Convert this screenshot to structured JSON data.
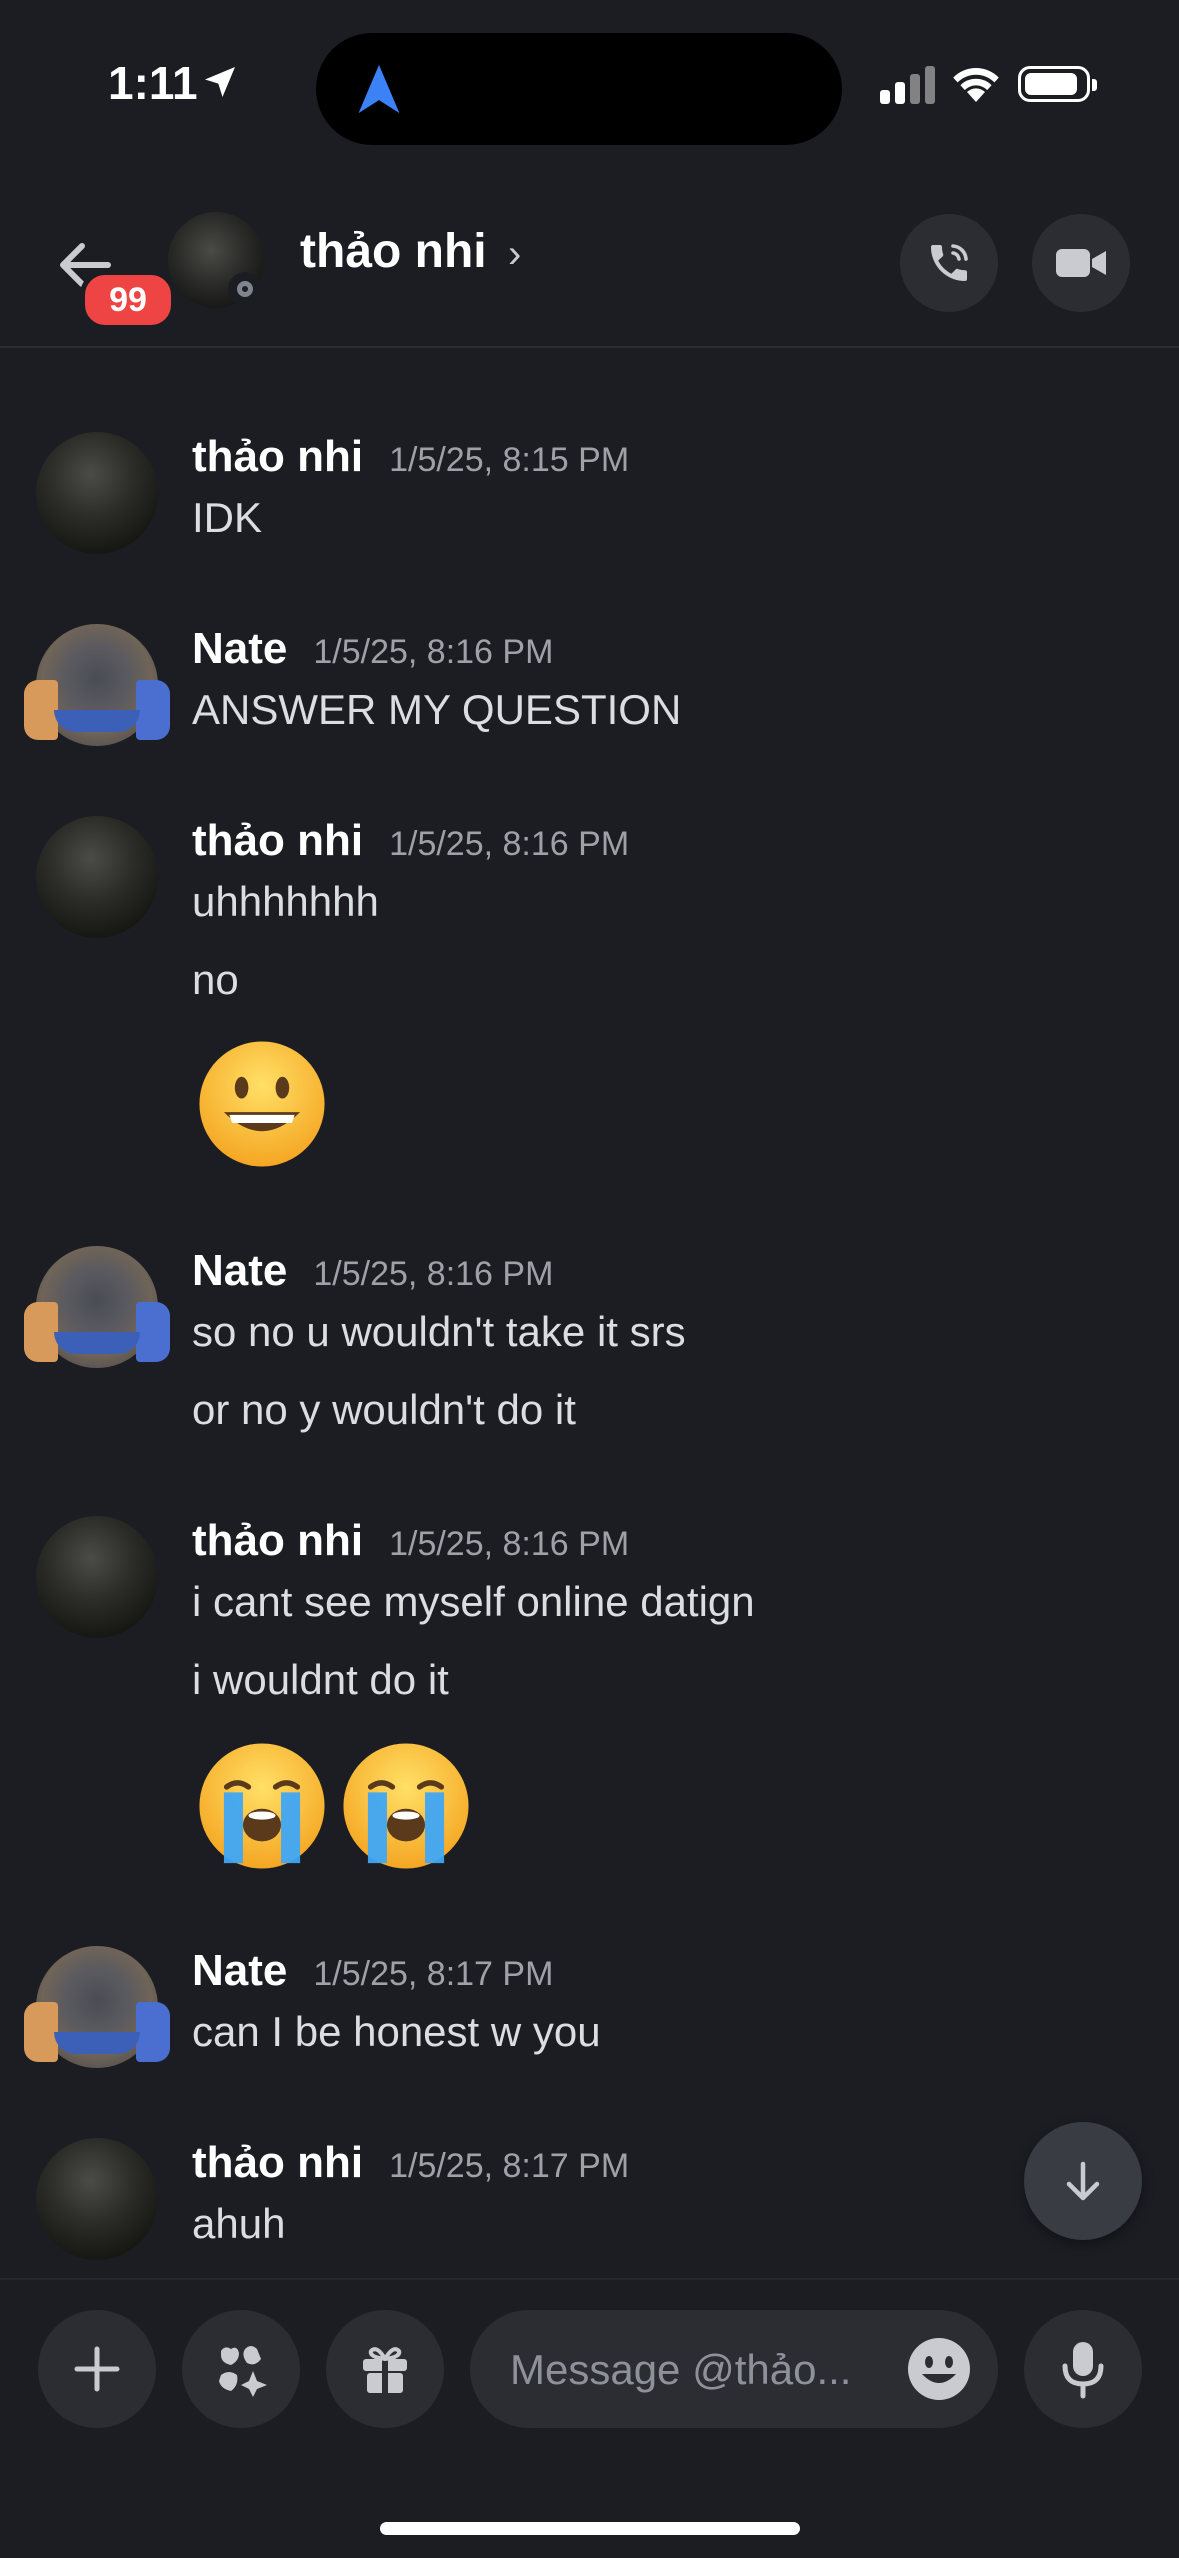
{
  "status_bar": {
    "time": "1:11"
  },
  "header": {
    "unread_badge": "99",
    "title": "thảo nhi",
    "chevron": "›"
  },
  "messages": [
    {
      "author": "thảo nhi",
      "timestamp": "1/5/25, 8:15 PM",
      "lines": [
        "IDK"
      ]
    },
    {
      "author": "Nate",
      "timestamp": "1/5/25, 8:16 PM",
      "lines": [
        "ANSWER MY QUESTION"
      ]
    },
    {
      "author": "thảo nhi",
      "timestamp": "1/5/25, 8:16 PM",
      "lines": [
        "uhhhhhhh",
        "no"
      ],
      "emoji": [
        "grinning-face"
      ]
    },
    {
      "author": "Nate",
      "timestamp": "1/5/25, 8:16 PM",
      "lines": [
        "so no u wouldn't take it srs",
        "or no y wouldn't do it"
      ]
    },
    {
      "author": "thảo nhi",
      "timestamp": "1/5/25, 8:16 PM",
      "lines": [
        "i cant see myself online datign",
        "i wouldnt do it"
      ],
      "emoji": [
        "loudly-crying-face",
        "loudly-crying-face"
      ]
    },
    {
      "author": "Nate",
      "timestamp": "1/5/25, 8:17 PM",
      "lines": [
        "can I be honest w you"
      ]
    },
    {
      "author": "thảo nhi",
      "timestamp": "1/5/25, 8:17 PM",
      "lines": [
        "ahuh"
      ]
    }
  ],
  "composer": {
    "placeholder": "Message @thảo..."
  },
  "icons": {
    "back": "back-arrow-icon",
    "call": "phone-call-icon",
    "video": "video-camera-icon",
    "add": "plus-icon",
    "apps": "apps-icon",
    "gift": "gift-icon",
    "emoji": "emoji-picker-icon",
    "mic": "microphone-icon",
    "scroll": "arrow-down-icon"
  },
  "colors": {
    "background": "#1c1d22",
    "badge": "#ef4444",
    "accent_blue": "#3b82f6"
  }
}
